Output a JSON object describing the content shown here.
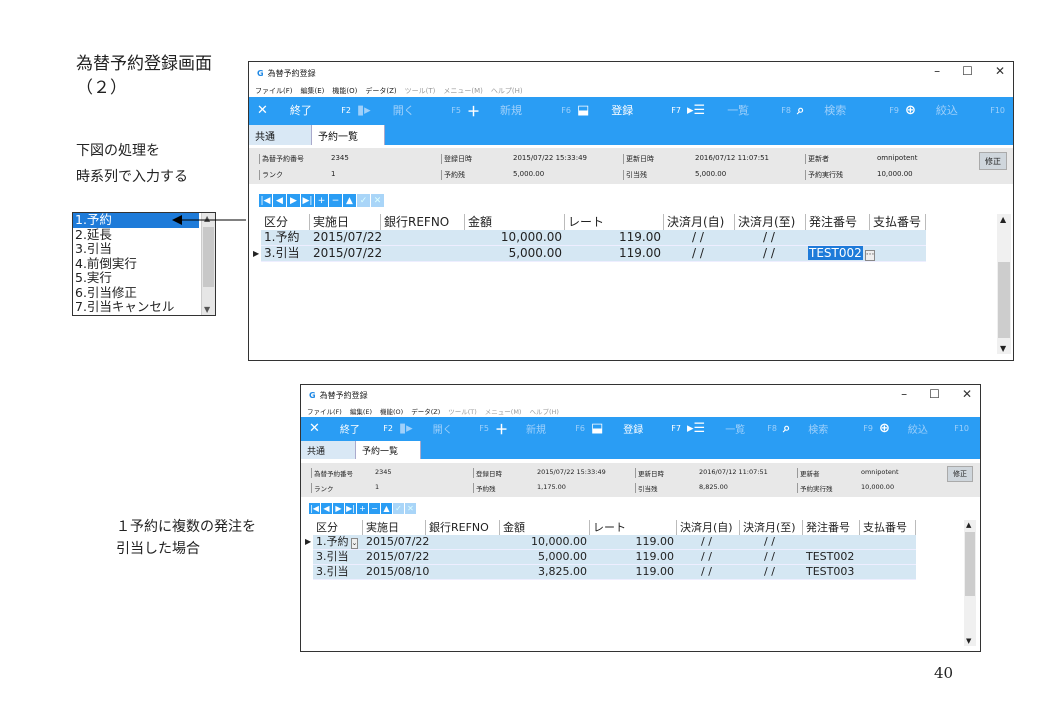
{
  "slide": {
    "title_line1": "為替予約登録画面",
    "title_line2": "（２）",
    "note_line1": "下図の処理を",
    "note_line2": "時系列で入力する",
    "note2_line1": "１予約に複数の発注を",
    "note2_line2": "引当した場合",
    "page_number": "40"
  },
  "listbox": {
    "items": [
      "1.予約",
      "2.延長",
      "3.引当",
      "4.前倒実行",
      "5.実行",
      "6.引当修正",
      "7.引当キャンセル"
    ],
    "selected_index": 0
  },
  "window": {
    "app_logo": "G",
    "title": "為替予約登録",
    "controls": {
      "minimize": "–",
      "maximize": "☐",
      "close": "✕"
    },
    "menu": [
      "ファイル(F)",
      "編集(E)",
      "機能(O)",
      "データ(Z)",
      "ツール(T)",
      "メニュー(M)",
      "ヘルプ(H)"
    ],
    "toolbar": [
      {
        "icon": "✕",
        "label": "終了",
        "fkey": "F2",
        "disabled": false
      },
      {
        "icon": "▮▸",
        "label": "開く",
        "fkey": "F5",
        "disabled": true
      },
      {
        "icon": "＋",
        "label": "新規",
        "fkey": "F6",
        "disabled": true
      },
      {
        "icon": "⬓",
        "label": "登録",
        "fkey": "F7",
        "disabled": false
      },
      {
        "icon": "▸☰",
        "label": "一覧",
        "fkey": "F8",
        "disabled": true
      },
      {
        "icon": "⌕",
        "label": "検索",
        "fkey": "F9",
        "disabled": true
      },
      {
        "icon": "⊕",
        "label": "絞込",
        "fkey": "F10",
        "disabled": true
      }
    ],
    "tabs": [
      "共通",
      "予約一覧"
    ],
    "active_tab": 1,
    "edit_button": "修正",
    "nav_buttons": [
      "|◀",
      "◀",
      "▶",
      "▶|",
      "+",
      "−",
      "▲",
      "✓",
      "✕"
    ],
    "columns": [
      "区分",
      "実施日",
      "銀行REFNO",
      "金額",
      "レート",
      "決済月(自)",
      "決済月(至)",
      "発注番号",
      "支払番号"
    ]
  },
  "window1": {
    "info": {
      "reservation_no_label": "為替予約番号",
      "reservation_no": "2345",
      "reg_date_label": "登録日時",
      "reg_date": "2015/07/22 15:33:49",
      "upd_date_label": "更新日時",
      "upd_date": "2016/07/12 11:07:51",
      "updater_label": "更新者",
      "updater": "omnipotent",
      "rank_label": "ランク",
      "rank": "1",
      "remaining_label": "予約残",
      "remaining": "5,000.00",
      "allocated_label": "引当残",
      "allocated": "5,000.00",
      "executed_label": "予約実行残",
      "executed": "10,000.00"
    },
    "rows": [
      {
        "kubun": "1.予約",
        "date": "2015/07/22",
        "ref": "",
        "amount": "10,000.00",
        "rate": "119.00",
        "from": "/ /",
        "to": "/ /",
        "order": "",
        "pay": "",
        "current": false
      },
      {
        "kubun": "3.引当",
        "date": "2015/07/22",
        "ref": "",
        "amount": "5,000.00",
        "rate": "119.00",
        "from": "/ /",
        "to": "/ /",
        "order": "TEST002",
        "pay": "",
        "current": true
      }
    ]
  },
  "window2": {
    "info": {
      "reservation_no_label": "為替予約番号",
      "reservation_no": "2345",
      "reg_date_label": "登録日時",
      "reg_date": "2015/07/22 15:33:49",
      "upd_date_label": "更新日時",
      "upd_date": "2016/07/12 11:07:51",
      "updater_label": "更新者",
      "updater": "omnipotent",
      "rank_label": "ランク",
      "rank": "1",
      "remaining_label": "予約残",
      "remaining": "1,175.00",
      "allocated_label": "引当残",
      "allocated": "8,825.00",
      "executed_label": "予約実行残",
      "executed": "10,000.00"
    },
    "rows": [
      {
        "kubun": "1.予約",
        "date": "2015/07/22",
        "ref": "",
        "amount": "10,000.00",
        "rate": "119.00",
        "from": "/ /",
        "to": "/ /",
        "order": "",
        "pay": "",
        "current": true
      },
      {
        "kubun": "3.引当",
        "date": "2015/07/22",
        "ref": "",
        "amount": "5,000.00",
        "rate": "119.00",
        "from": "/ /",
        "to": "/ /",
        "order": "TEST002",
        "pay": "",
        "current": false
      },
      {
        "kubun": "3.引当",
        "date": "2015/08/10",
        "ref": "",
        "amount": "3,825.00",
        "rate": "119.00",
        "from": "/ /",
        "to": "/ /",
        "order": "TEST003",
        "pay": "",
        "current": false
      }
    ]
  }
}
